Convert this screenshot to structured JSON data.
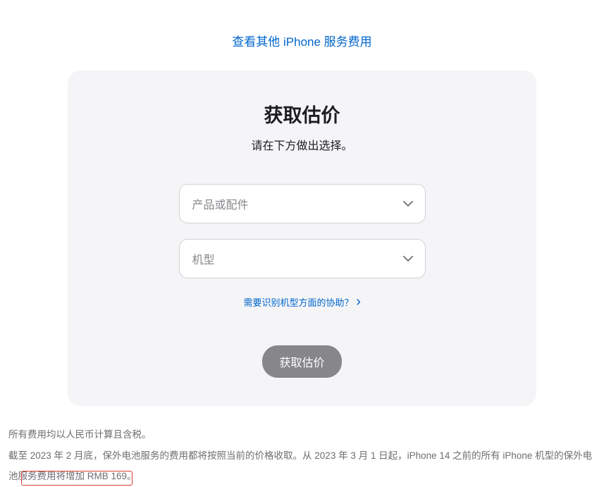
{
  "topLink": {
    "text": "查看其他 iPhone 服务费用"
  },
  "card": {
    "title": "获取估价",
    "subtitle": "请在下方做出选择。",
    "productSelect": {
      "placeholder": "产品或配件"
    },
    "modelSelect": {
      "placeholder": "机型"
    },
    "helpLink": {
      "text": "需要识别机型方面的协助？"
    },
    "submitButton": {
      "label": "获取估价"
    }
  },
  "disclaimer": {
    "line1": "所有费用均以人民币计算且含税。",
    "line2": "截至 2023 年 2 月底，保外电池服务的费用都将按照当前的价格收取。从 2023 年 3 月 1 日起，iPhone 14 之前的所有 iPhone 机型的保外电池服务费用将增加 RMB 169。"
  }
}
